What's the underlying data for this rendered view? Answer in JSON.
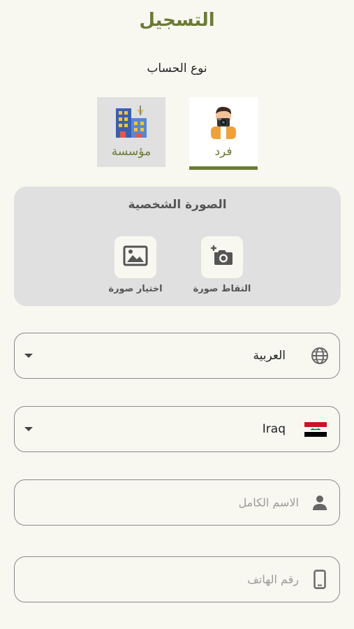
{
  "header": {
    "title": "التسجيل"
  },
  "account_type": {
    "label": "نوع الحساب",
    "options": [
      {
        "label": "فرد",
        "selected": true,
        "icon": "photographer-person-icon"
      },
      {
        "label": "مؤسسة",
        "selected": false,
        "icon": "building-icon"
      }
    ]
  },
  "profile_photo": {
    "title": "الصورة الشخصية",
    "camera_label": "التقاط صورة",
    "gallery_label": "اختيار صورة"
  },
  "language_select": {
    "value": "العربية",
    "icon": "globe-icon"
  },
  "country_select": {
    "value": "Iraq",
    "icon": "iraq-flag-icon"
  },
  "name_field": {
    "placeholder": "الاسم الكامل",
    "icon": "person-icon"
  },
  "phone_field": {
    "placeholder": "رقم الهاتف",
    "icon": "phone-icon"
  },
  "colors": {
    "accent": "#6b7b34",
    "background": "#f8f8f1",
    "panel": "#e0e0e0"
  }
}
